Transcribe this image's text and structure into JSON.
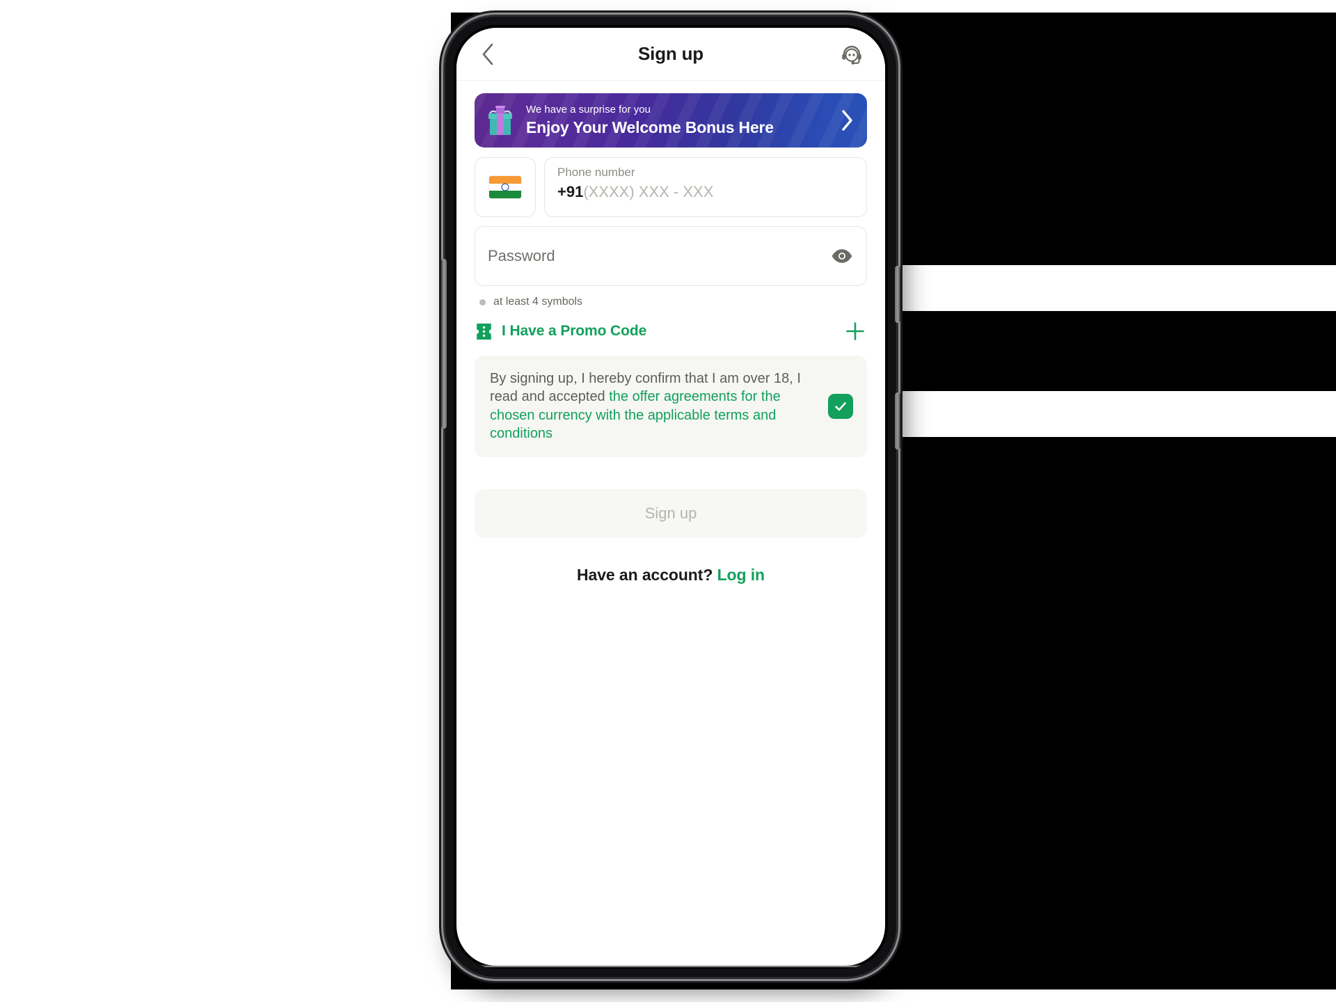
{
  "header": {
    "title": "Sign up",
    "back_icon": "chevron-left-icon",
    "support_icon": "headset-support-icon"
  },
  "banner": {
    "eyebrow": "We have a surprise for you",
    "headline": "Enjoy Your Welcome Bonus Here",
    "icon": "gift-icon",
    "chevron": "chevron-right-icon",
    "gradient_from": "#5d2a8f",
    "gradient_to": "#2952b8"
  },
  "phone_field": {
    "flag": "india-flag-icon",
    "label": "Phone number",
    "country_code": "+91",
    "placeholder": "(XXXX) XXX - XXX"
  },
  "password_field": {
    "placeholder": "Password",
    "toggle_icon": "eye-icon"
  },
  "password_hint": {
    "text": "at least 4 symbols"
  },
  "promo": {
    "icon": "ticket-icon",
    "label": "I Have a Promo Code",
    "add_icon": "plus-icon"
  },
  "terms": {
    "plain_text": "By signing up, I hereby confirm that I am over 18, I read and accepted ",
    "link_text": "the offer agreements for the chosen currency with the applicable terms and conditions",
    "checked": true,
    "check_glyph": "✓"
  },
  "actions": {
    "signup_label": "Sign up",
    "signup_disabled": true,
    "have_account_text": "Have an account? ",
    "login_label": "Log in"
  },
  "colors": {
    "accent_green": "#12A05C",
    "text_dark": "#1b1b1b",
    "text_muted": "#8b8b86",
    "field_border": "#e6e6e4",
    "surface_gray": "#f6f6f3"
  }
}
